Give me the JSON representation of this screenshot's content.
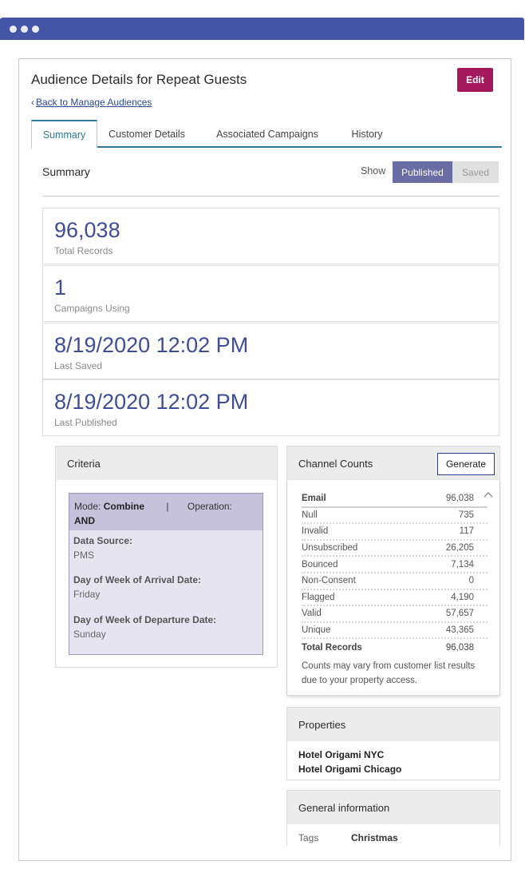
{
  "header": {
    "title": "Audience Details for Repeat Guests",
    "back_link": "Back to Manage Audiences",
    "edit_label": "Edit"
  },
  "tabs": [
    {
      "label": "Summary",
      "active": true
    },
    {
      "label": "Customer Details",
      "active": false
    },
    {
      "label": "Associated Campaigns",
      "active": false
    },
    {
      "label": "History",
      "active": false
    }
  ],
  "summary": {
    "heading": "Summary",
    "show_label": "Show",
    "toggle": {
      "published": "Published",
      "saved": "Saved",
      "selected": "Published"
    }
  },
  "stats": [
    {
      "value": "96,038",
      "label": "Total Records"
    },
    {
      "value": "1",
      "label": "Campaigns Using"
    },
    {
      "value": "8/19/2020 12:02 PM",
      "label": "Last Saved"
    },
    {
      "value": "8/19/2020 12:02 PM",
      "label": "Last Published"
    }
  ],
  "criteria": {
    "heading": "Criteria",
    "mode_label": "Mode:",
    "mode_value": "Combine",
    "operation_label": "Operation:",
    "operation_value": "AND",
    "fields": [
      {
        "key": "Data Source:",
        "value": "PMS"
      },
      {
        "key": "Day of Week of Arrival Date:",
        "value": "Friday"
      },
      {
        "key": "Day of Week of Departure Date:",
        "value": "Sunday"
      }
    ]
  },
  "channel_counts": {
    "heading": "Channel Counts",
    "generate_label": "Generate",
    "channel": {
      "label": "Email",
      "value": "96,038"
    },
    "rows": [
      {
        "label": "Null",
        "value": "735"
      },
      {
        "label": "Invalid",
        "value": "117"
      },
      {
        "label": "Unsubscribed",
        "value": "26,205"
      },
      {
        "label": "Bounced",
        "value": "7,134"
      },
      {
        "label": "Non-Consent",
        "value": "0"
      },
      {
        "label": "Flagged",
        "value": "4,190"
      },
      {
        "label": "Valid",
        "value": "57,657"
      },
      {
        "label": "Unique",
        "value": "43,365"
      }
    ],
    "total": {
      "label": "Total Records",
      "value": "96,038"
    },
    "note": "Counts may vary from customer list results due to your property access."
  },
  "properties": {
    "heading": "Properties",
    "items": [
      "Hotel Origami NYC",
      "Hotel Origami Chicago"
    ]
  },
  "general_info": {
    "heading": "General information",
    "tags_label": "Tags",
    "tags_value": "Christmas"
  },
  "colors": {
    "window_bar": "#4355a4",
    "edit_button": "#a3195b",
    "tab_accent": "#2c7c99",
    "stat_value": "#3e4d96",
    "toggle_active": "#6a6da3",
    "criteria_header": "#c6c2db",
    "criteria_body": "#e7e4f1"
  },
  "icons": {
    "window_dots": "three-dots-icon",
    "back": "chevron-left-icon",
    "collapse": "chevron-up-icon"
  }
}
